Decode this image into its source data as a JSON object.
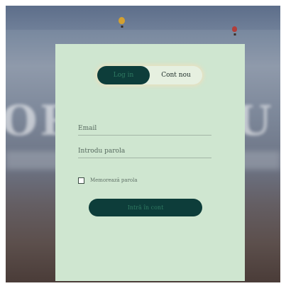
{
  "background": {
    "heading_text": "ORI IN J U L I"
  },
  "auth_switch": {
    "login_label": "Log in",
    "register_label": "Cont nou"
  },
  "form": {
    "email_placeholder": "Email",
    "password_placeholder": "Introdu parola",
    "remember_label": "Memorează parola",
    "submit_label": "Intră în cont"
  },
  "colors": {
    "panel": "#cfe6d0",
    "accent_dark": "#0d3d3a",
    "accent_text": "#2f7a62"
  }
}
